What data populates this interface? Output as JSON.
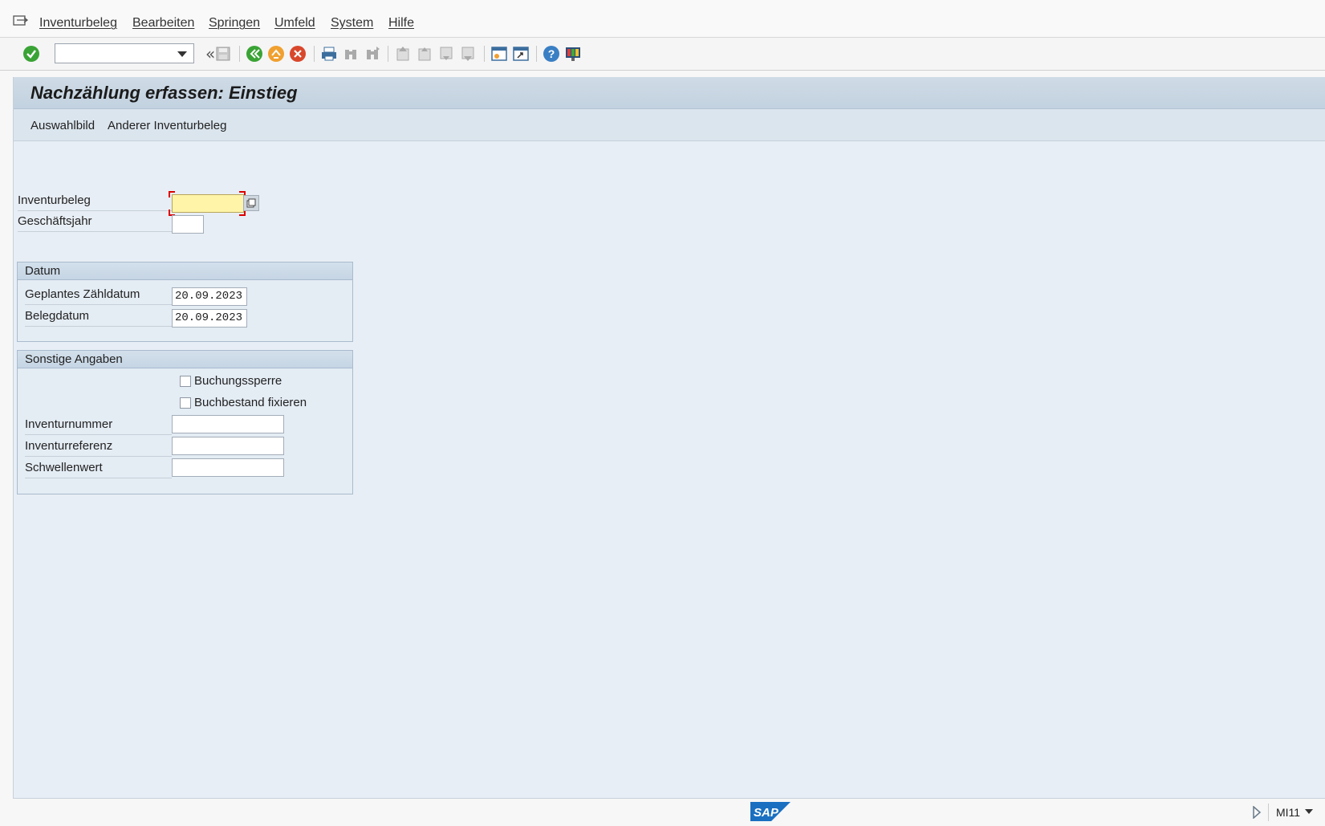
{
  "menu": {
    "items": [
      "Inventurbeleg",
      "Bearbeiten",
      "Springen",
      "Umfeld",
      "System",
      "Hilfe"
    ]
  },
  "toolbar": {
    "command_field": "",
    "icons": [
      "enter-icon",
      "back-icon",
      "exit-icon",
      "cancel-icon",
      "save-icon",
      "print-icon",
      "find-icon",
      "find-next-icon",
      "first-page-icon",
      "prev-page-icon",
      "next-page-icon",
      "last-page-icon",
      "new-session-icon",
      "shortcut-icon",
      "help-icon",
      "customize-layout-icon"
    ]
  },
  "title": "Nachzählung erfassen: Einstieg",
  "app_toolbar": {
    "btn1": "Auswahlbild",
    "btn2": "Anderer Inventurbeleg"
  },
  "form": {
    "inventurbeleg_label": "Inventurbeleg",
    "inventurbeleg_value": "",
    "geschaeftsjahr_label": "Geschäftsjahr",
    "geschaeftsjahr_value": ""
  },
  "datum": {
    "title": "Datum",
    "geplant_label": "Geplantes Zähldatum",
    "geplant_value": "20.09.2023",
    "beleg_label": "Belegdatum",
    "beleg_value": "20.09.2023"
  },
  "sonstige": {
    "title": "Sonstige Angaben",
    "buchungssperre_label": "Buchungssperre",
    "buchungssperre_checked": false,
    "buchbestand_label": "Buchbestand fixieren",
    "buchbestand_checked": false,
    "inventurnummer_label": "Inventurnummer",
    "inventurnummer_value": "",
    "inventurreferenz_label": "Inventurreferenz",
    "inventurreferenz_value": "",
    "schwellenwert_label": "Schwellenwert",
    "schwellenwert_value": ""
  },
  "status": {
    "logo_text": "SAP",
    "transaction": "MI11"
  },
  "colors": {
    "accent": "#c3d2e0",
    "focus_field": "#fff4a8",
    "enter_green": "#3aa335",
    "cancel_red": "#d9472b",
    "sap_blue": "#1a6fc0"
  }
}
